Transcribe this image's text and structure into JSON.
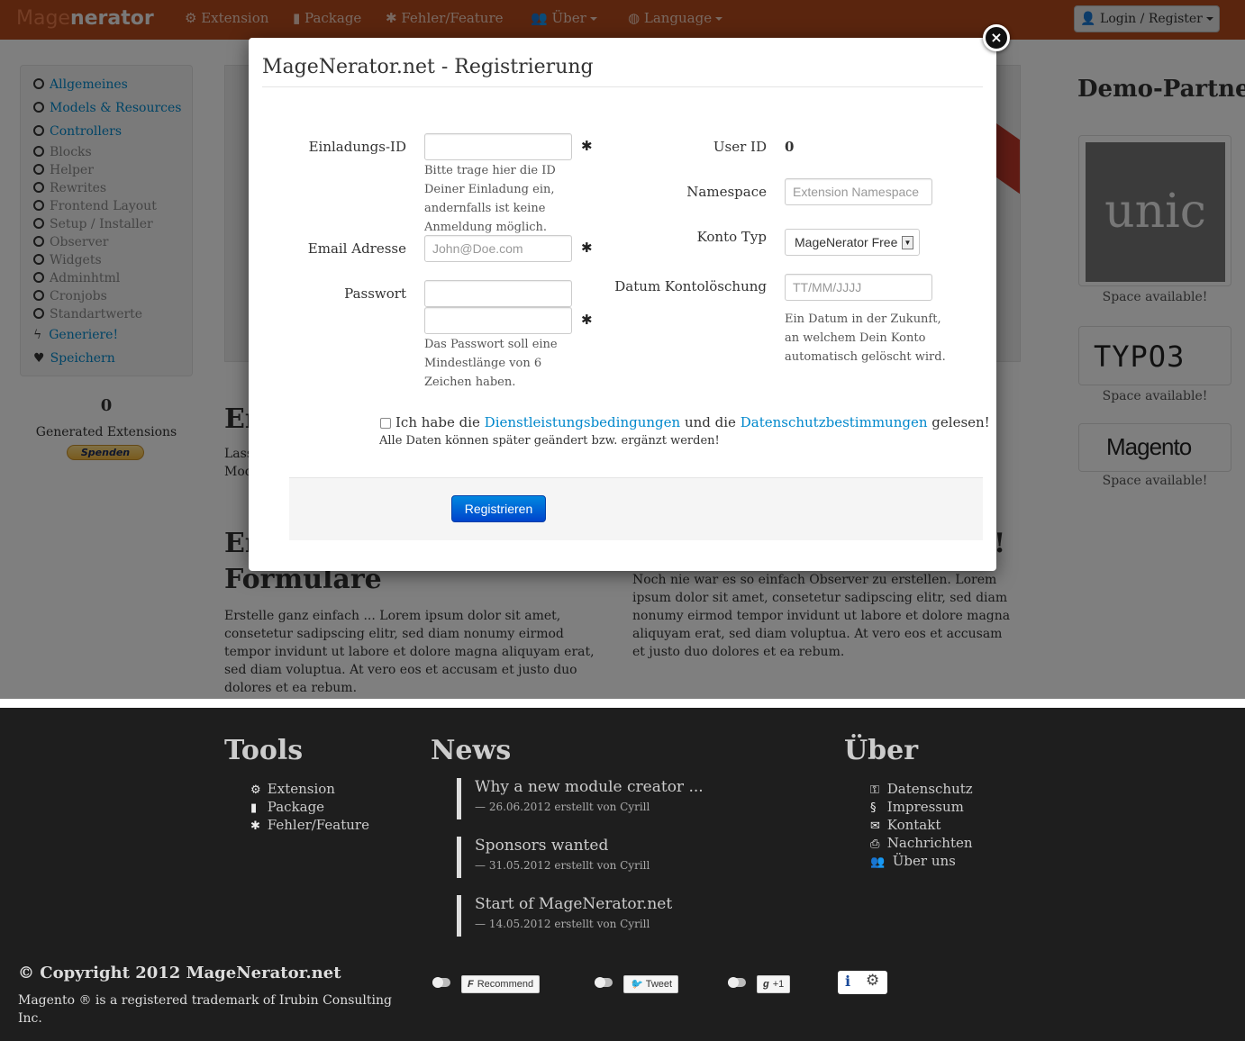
{
  "navbar": {
    "brand_part1": "Mage",
    "brand_part2": "nerator",
    "items": [
      "Extension",
      "Package",
      "Fehler/Feature",
      "Über",
      "Language"
    ],
    "login_label": "Login / Register"
  },
  "sidebar": {
    "items": [
      "Allgemeines",
      "Models & Resources",
      "Controllers",
      "Blocks",
      "Helper",
      "Rewrites",
      "Frontend Layout",
      "Setup / Installer",
      "Observer",
      "Widgets",
      "Adminhtml",
      "Cronjobs",
      "Standartwerte"
    ],
    "generate_label": "Generiere!",
    "save_label": "Speichern",
    "generated_count": "0",
    "generated_label": "Generated Extensions",
    "donate_label": "Spenden"
  },
  "background": {
    "h_left_top": "Er",
    "p_left_top_1": "Lass",
    "p_left_top_2": "Mod",
    "h_left_bottom_1": "Er",
    "h_left_bottom_2": "Formulare",
    "p_left_bottom": "Erstelle ganz einfach ... Lorem ipsum dolor sit amet, consetetur sadipscing elitr, sed diam nonumy eirmod tempor invidunt ut labore et dolore magna aliquyam erat, sed diam voluptua. At vero eos et accusam et justo duo dolores et ea rebum.",
    "h_right_bottom": "!",
    "p_right_bottom": "Noch nie war es so einfach Observer zu erstellen. Lorem ipsum dolor sit amet, consetetur sadipscing elitr, sed diam nonumy eirmod tempor invidunt ut labore et dolore magna aliquyam erat, sed diam voluptua. At vero eos et accusam et justo duo dolores et ea rebum."
  },
  "demo_partner": {
    "title": "Demo-Partner",
    "logos": [
      "unic",
      "TYPO3",
      "Magento"
    ],
    "space_label": "Space available!"
  },
  "modal": {
    "title": "MageNerator.net - Registrierung",
    "close_label": "×",
    "invite_label": "Einladungs-ID",
    "invite_value": "",
    "invite_help": "Bitte trage hier die ID Deiner Einladung ein, andernfalls ist keine Anmeldung möglich.",
    "email_label": "Email Adresse",
    "email_placeholder": "John@Doe.com",
    "password_label": "Passwort",
    "password_help": "Das Passwort soll eine Mindestlänge von 6 Zeichen haben.",
    "required_mark": "✱",
    "userid_label": "User ID",
    "userid_value": "0",
    "namespace_label": "Namespace",
    "namespace_placeholder": "Extension Namespace",
    "account_type_label": "Konto Typ",
    "account_type_value": "MageNerator Free",
    "delete_date_label": "Datum Kontolöschung",
    "delete_date_placeholder": "TT/MM/JJJJ",
    "delete_date_help": "Ein Datum in der Zukunft, an welchem Dein Konto automatisch gelöscht wird.",
    "terms_prefix": "Ich habe die",
    "terms_link1": "Dienstleistungsbedingungen",
    "terms_middle": "und die",
    "terms_link2": "Datenschutzbestimmungen",
    "terms_suffix": "gelesen!",
    "terms_note": "Alle Daten können später geändert bzw. ergänzt werden!",
    "submit_label": "Registrieren"
  },
  "footer": {
    "tools_title": "Tools",
    "tools_links": [
      "Extension",
      "Package",
      "Fehler/Feature"
    ],
    "news_title": "News",
    "news": [
      {
        "title": "Why a new module creator ...",
        "meta": "—  26.06.2012 erstellt von Cyrill"
      },
      {
        "title": "Sponsors wanted",
        "meta": "—  31.05.2012 erstellt von Cyrill"
      },
      {
        "title": "Start of MageNerator.net",
        "meta": "—  14.05.2012 erstellt von Cyrill"
      }
    ],
    "about_title": "Über",
    "about_links": [
      "Datenschutz",
      "Impressum",
      "Kontakt",
      "Nachrichten",
      "Über uns"
    ],
    "copyright": "© Copyright 2012 MageNerator.net",
    "trademark": "Magento ® is a registered trademark of Irubin Consulting Inc.",
    "social": {
      "recommend": "Recommend",
      "tweet": "Tweet",
      "plusone": "+1"
    },
    "info_label": "i"
  }
}
